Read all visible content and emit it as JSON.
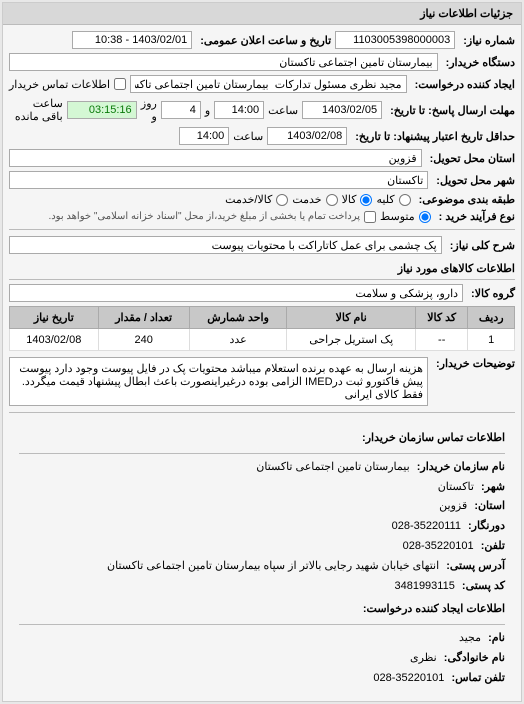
{
  "header": {
    "panel_title": "جزئیات اطلاعات نیاز"
  },
  "info": {
    "need_number_label": "شماره نیاز:",
    "need_number": "1103005398000003",
    "public_time_label": "تاریخ و ساعت اعلان عمومی:",
    "public_time": "1403/02/01 - 10:38",
    "buyer_org_label": "دستگاه خریدار:",
    "buyer_org": "بیمارستان تامین اجتماعی تاکستان",
    "requester_label": "ایجاد کننده درخواست:",
    "requester": "مجید نظری مسئول تدارکات  بیمارستان تامین اجتماعی تاکستان",
    "buyer_contact_label": "اطلاعات تماس خریدار",
    "deadline_label": "مهلت ارسال پاسخ: تا تاریخ:",
    "deadline_date": "1403/02/05",
    "hour_label": "ساعت",
    "deadline_hour": "14:00",
    "countdown_and": "و",
    "countdown_days": "4",
    "countdown_days_label": "روز و",
    "countdown_time": "03:15:16",
    "countdown_remain": "ساعت باقی مانده",
    "valid_until_label": "حداقل تاریخ اعتبار پیشنهاد: تا تاریخ:",
    "valid_until_date": "1403/02/08",
    "valid_until_hour": "14:00",
    "province_label": "استان محل تحویل:",
    "province": "قزوین",
    "city_label": "شهر محل تحویل:",
    "city": "تاکستان",
    "pack_label": "طبقه بندی موضوعی:",
    "pack_all": "کلیه",
    "pack_good": "کالا",
    "pack_service": "خدمت",
    "pack_goodservice": "کالا/خدمت",
    "pay_label": "نوع فرآیند خرید :",
    "pay_mid": "متوسط",
    "pay_note": "پرداخت تمام یا بخشی از مبلغ خرید،از محل \"اسناد خزانه اسلامی\" خواهد بود.",
    "desc_label": "شرح کلی نیاز:",
    "desc_value": "پک چشمی برای عمل کاتاراکت با محتویات پیوست",
    "items_section": "اطلاعات کالاهای مورد نیاز",
    "group_label": "گروه کالا:",
    "group_value": "دارو، پزشکی و سلامت",
    "buyer_desc_label": "توضیحات خریدار:",
    "buyer_desc_value": "هزینه ارسال به عهده برنده استعلام میباشد محتویات پک در فایل پیوست وجود دارد پیوست پیش فاکتورو ثبت درIMED الزامی بوده درغیراینصورت باعث ابطال پیشنهاد قیمت میگردد. فقط کالای ایرانی"
  },
  "table": {
    "headers": {
      "row": "ردیف",
      "code": "کد کالا",
      "name": "نام کالا",
      "unit": "واحد شمارش",
      "qty": "تعداد / مقدار",
      "date": "تاریخ نیاز"
    },
    "rows": [
      {
        "row": "1",
        "code": "--",
        "name": "پک استریل جراحی",
        "unit": "عدد",
        "qty": "240",
        "date": "1403/02/08"
      }
    ]
  },
  "contacts": {
    "title": "اطلاعات تماس سازمان خریدار:",
    "org_name_label": "نام سازمان خریدار:",
    "org_name": "بیمارستان تامین اجتماعی تاکستان",
    "city_label": "شهر:",
    "city": "تاکستان",
    "province_label": "استان:",
    "province": "قزوین",
    "fax_label": "دورنگار:",
    "fax": "35220111-028",
    "phone_label": "تلفن:",
    "phone": "35220101-028",
    "postal_label": "آدرس پستی:",
    "postal": "انتهای خیابان شهید رجایی بالاتر از سپاه بیمارستان تامین اجتماعی تاکستان",
    "zip_label": "کد پستی:",
    "zip": "3481993115",
    "req_contact_title": "اطلاعات ایجاد کننده درخواست:",
    "person_name_label": "نام:",
    "person_name": "مجید",
    "person_family_label": "نام خانوادگی:",
    "person_family": "نظری",
    "person_phone_label": "تلفن تماس:",
    "person_phone": "35220101-028"
  }
}
